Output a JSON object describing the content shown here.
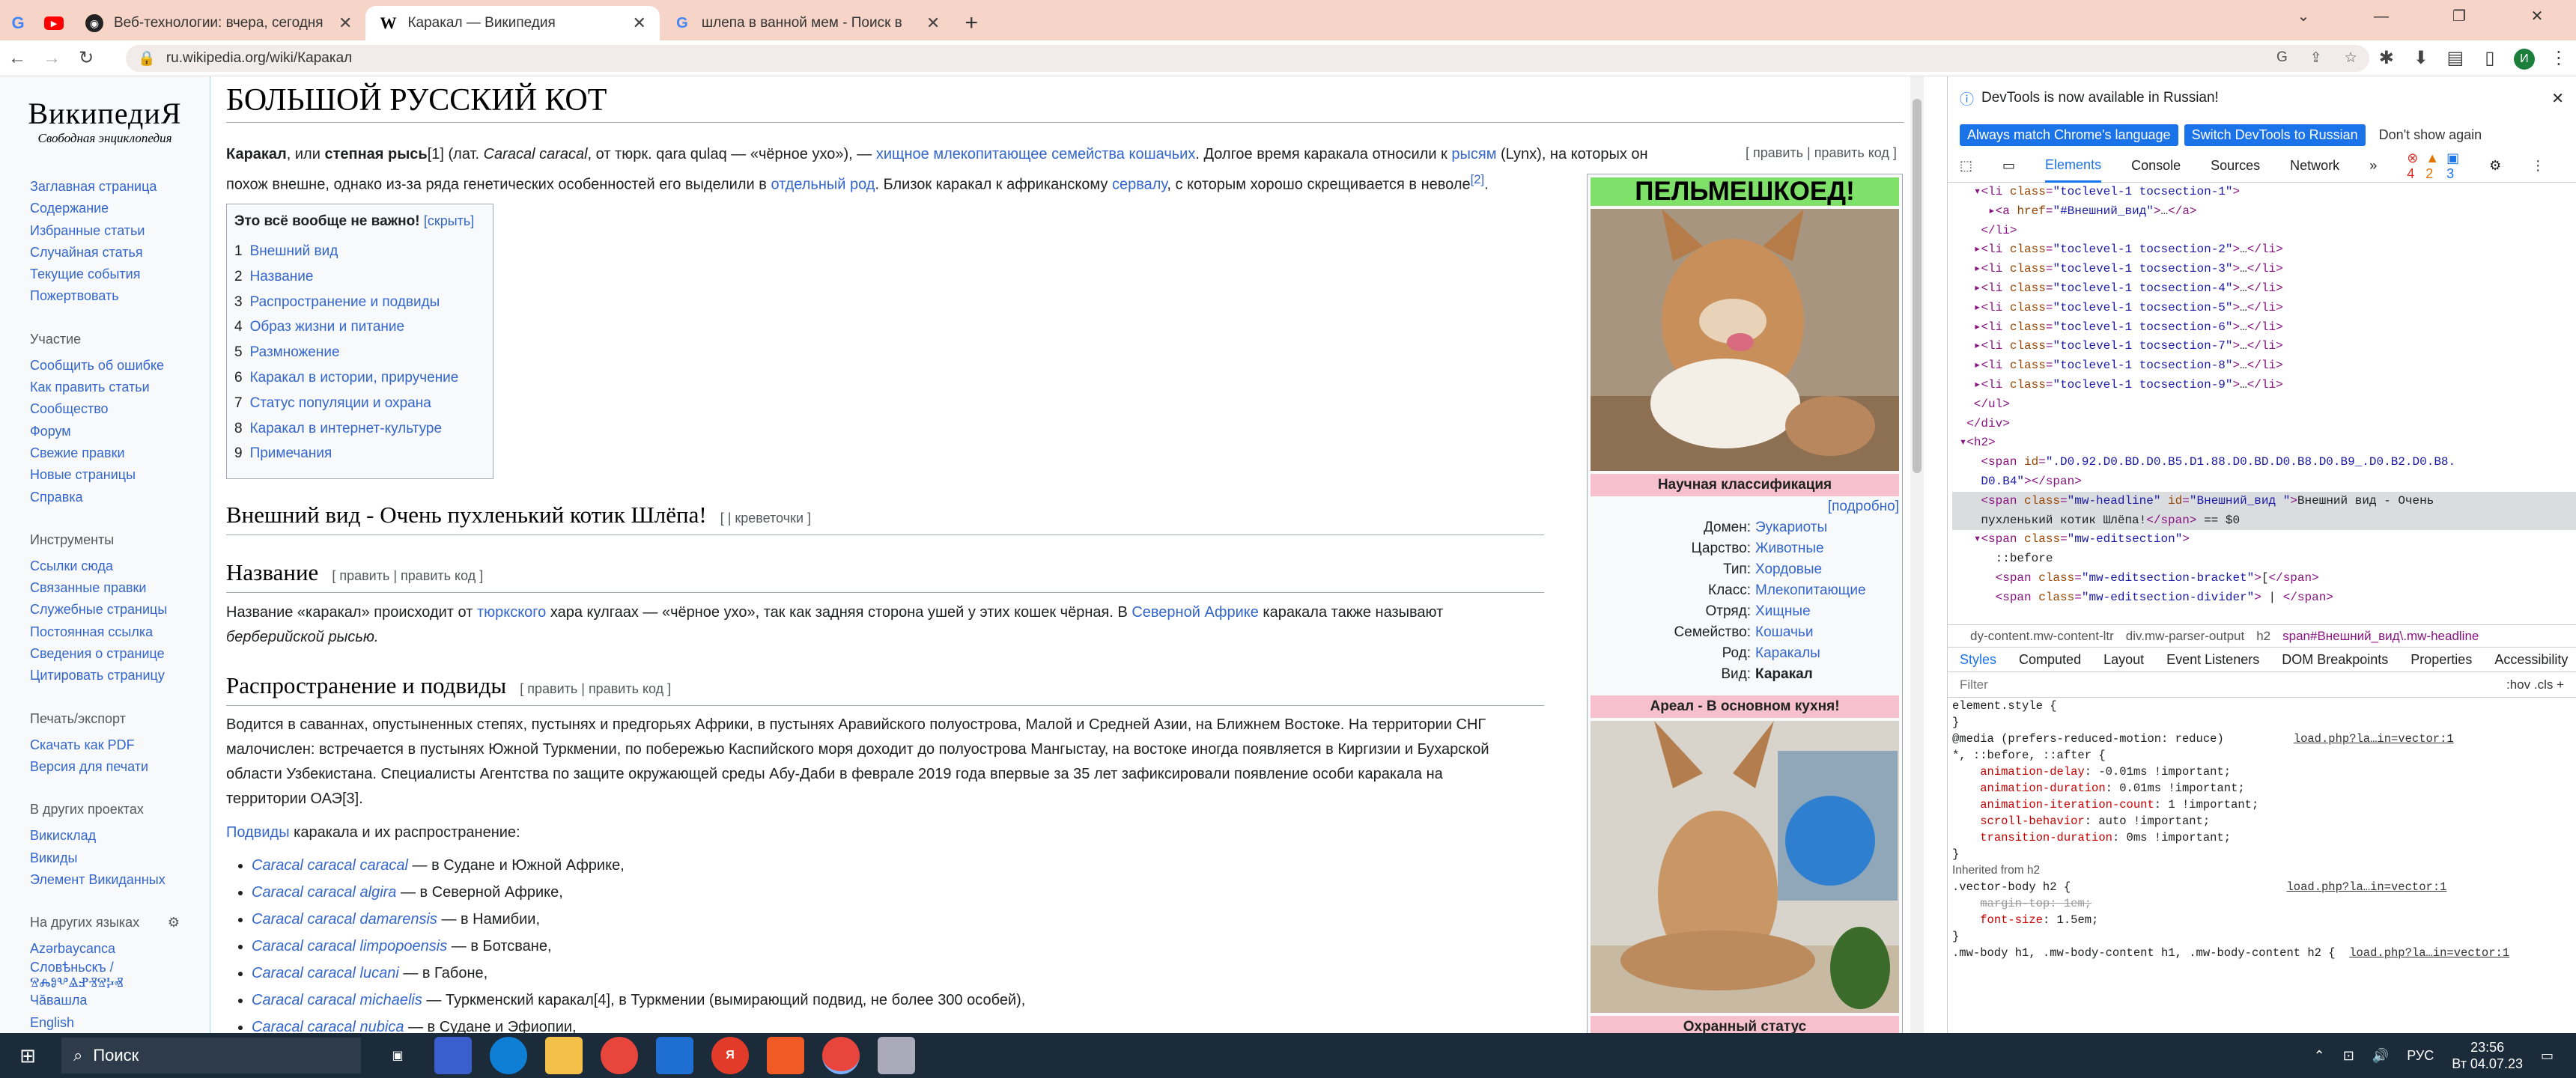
{
  "browser": {
    "tabs": [
      {
        "label": "Веб-технологии: вчера, сегодня",
        "active": false
      },
      {
        "label": "Каракал — Википедия",
        "active": true
      },
      {
        "label": "шлепа в ванной мем - Поиск в",
        "active": false
      }
    ],
    "new_tab": "+",
    "url": "ru.wikipedia.org/wiki/Каракал",
    "window_controls": [
      "⌄",
      "—",
      "❐",
      "✕"
    ]
  },
  "wiki": {
    "logo_title": "ВикипедиЯ",
    "logo_subtitle": "Свободная энциклопедия",
    "nav_main": [
      "Заглавная страница",
      "Содержание",
      "Избранные статьи",
      "Случайная статья",
      "Текущие события",
      "Пожертвовать"
    ],
    "nav_participation_head": "Участие",
    "nav_participation": [
      "Сообщить об ошибке",
      "Как править статьи",
      "Сообщество",
      "Форум",
      "Свежие правки",
      "Новые страницы",
      "Справка"
    ],
    "nav_tools_head": "Инструменты",
    "nav_tools": [
      "Ссылки сюда",
      "Связанные правки",
      "Служебные страницы",
      "Постоянная ссылка",
      "Сведения о странице",
      "Цитировать страницу"
    ],
    "nav_print_head": "Печать/экспорт",
    "nav_print": [
      "Скачать как PDF",
      "Версия для печати"
    ],
    "nav_projects_head": "В других проектах",
    "nav_projects": [
      "Викисклад",
      "Викиды",
      "Элемент Викиданных"
    ],
    "nav_lang_head": "На других языках",
    "nav_lang": [
      "Azərbaycanca",
      "Словѣньскъ / ⰔⰎⰑⰂⰡⰐⰠⰔⰍⰟ",
      "Чăвашла",
      "English"
    ],
    "title": "БОЛЬШОЙ РУССКИЙ КОТ",
    "intro_line1_a": "Каракал",
    "intro_line1_b": ", или ",
    "intro_line1_c": "степная рысь",
    "intro_line1_d": "[1] (лат. ",
    "intro_line1_e": "Caracal caracal",
    "intro_line1_f": ", от тюрк. qara qulaq — «чёрное ухо»), — ",
    "intro_link1": "хищное",
    "intro_link2": "млекопитающее",
    "intro_link3": "семейства",
    "intro_link4": "кошачьих",
    "intro_line1_g": ". Долгое время каракала относили к ",
    "intro_link5": "рысям",
    "intro_line1_h": " (Lynx), на которых он",
    "intro_line2_a": "похож внешне, однако из-за ряда генетических особенностей его выделили в ",
    "intro_link6": "отдельный род",
    "intro_line2_b": ". Близок каракал к африканскому ",
    "intro_link7": "сервалу",
    "intro_line2_c": ", с которым хорошо скрещивается в неволе",
    "intro_ref2": "[2]",
    "intro_line2_d": ".",
    "edit_links": "[ править | править код ]",
    "toc_title": "Это всё вообще не важно!",
    "toc_hide": "[скрыть]",
    "toc": [
      {
        "n": "1",
        "t": "Внешний вид"
      },
      {
        "n": "2",
        "t": "Название"
      },
      {
        "n": "3",
        "t": "Распространение и подвиды"
      },
      {
        "n": "4",
        "t": "Образ жизни и питание"
      },
      {
        "n": "5",
        "t": "Размножение"
      },
      {
        "n": "6",
        "t": "Каракал в истории, приручение"
      },
      {
        "n": "7",
        "t": "Статус популяции и охрана"
      },
      {
        "n": "8",
        "t": "Каракал в интернет-культуре"
      },
      {
        "n": "9",
        "t": "Примечания"
      }
    ],
    "h_vneshniy": "Внешний вид - Очень пухленький котик Шлёпа!",
    "h_vneshniy_edit": "[ | креветочки ]",
    "h_nazvanie": "Название",
    "h_nazvanie_edit": "[ править | править код ]",
    "nazvanie_a": "Название «каракал» происходит от ",
    "nazvanie_link1": "тюркского",
    "nazvanie_b": " хара кулгаах — «чёрное ухо», так как задняя сторона ушей у этих кошек чёрная. В ",
    "nazvanie_link2": "Северной Африке",
    "nazvanie_c": " каракала также называют",
    "nazvanie_d": "берберийской рысью.",
    "h_rasprostr": "Распространение и подвиды",
    "h_rasprostr_edit": "[ править | править код ]",
    "r_line1": "Водится в саваннах, опустыненных степях, пустынях и предгорьях Африки, в пустынях Аравийского полуострова, Малой и Средней Азии, на Ближнем Востоке. На территории СНГ",
    "r_line2": "малочислен: встречается в пустынях Южной Туркмении, по побережью Каспийского моря доходит до полуострова Мангыстау, на востоке иногда появляется в Киргизии и Бухарской",
    "r_line3": "области Узбекистана. Специалисты Агентства по защите окружающей среды Абу-Даби в феврале 2019 года впервые за 35 лет зафиксировали появление особи каракала на",
    "r_line4": "территории ОАЭ[3].",
    "podvidy_a": "Подвиды",
    "podvidy_b": " каракала и их распространение:",
    "subspecies": [
      {
        "name": "Caracal caracal caracal",
        "rest": " — в Судане и Южной Африке,"
      },
      {
        "name": "Caracal caracal algira",
        "rest": " — в Северной Африке,"
      },
      {
        "name": "Caracal caracal damarensis",
        "rest": " — в Намибии,"
      },
      {
        "name": "Caracal caracal limpopoensis",
        "rest": " — в Ботсване,"
      },
      {
        "name": "Caracal caracal lucani",
        "rest": " — в Габоне,"
      },
      {
        "name": "Caracal caracal michaelis",
        "rest": " — Туркменский каракал[4], в Туркмении (вымирающий подвид, не более 300 особей),"
      },
      {
        "name": "Caracal caracal nubica",
        "rest": " — в Судане и Эфиопии,"
      }
    ],
    "infobox": {
      "head": "ПЕЛЬМЕШКОЕД!",
      "sci": "Научная классификация",
      "more": "[подробно]",
      "rows": [
        {
          "k": "Домен:",
          "v": "Эукариоты"
        },
        {
          "k": "Царство:",
          "v": "Животные"
        },
        {
          "k": "Тип:",
          "v": "Хордовые"
        },
        {
          "k": "Класс:",
          "v": "Млекопитающие"
        },
        {
          "k": "Отряд:",
          "v": "Хищные"
        },
        {
          "k": "Семейство:",
          "v": "Кошачьи"
        },
        {
          "k": "Род:",
          "v": "Каракалы"
        },
        {
          "k": "Вид:",
          "v": "Каракал"
        }
      ],
      "area": "Ареал - В основном кухня!",
      "status": "Охранный статус"
    }
  },
  "devtools": {
    "notice": "DevTools is now available in Russian!",
    "btn1": "Always match Chrome's language",
    "btn2": "Switch DevTools to Russian",
    "btn3": "Don't show again",
    "tabs": [
      "Elements",
      "Console",
      "Sources",
      "Network",
      "»"
    ],
    "errors": "4",
    "warnings": "2",
    "info": "3",
    "crumbs": [
      "dy-content.mw-content-ltr",
      "div.mw-parser-output",
      "h2",
      "span#Внешний_вид\\.mw-headline"
    ],
    "style_tabs": [
      "Styles",
      "Computed",
      "Layout",
      "Event Listeners",
      "DOM Breakpoints",
      "Properties",
      "Accessibility"
    ],
    "filter": "Filter",
    "filter_right": ":hov  .cls  +",
    "inherited": "Inherited from h2",
    "source1": "load.php?la…in=vector:1",
    "source2": "load.php?la…in=vector:1",
    "source3": "load.php?la…in=vector:1"
  },
  "taskbar": {
    "search": "Поиск",
    "lang": "РУС",
    "time": "23:56",
    "date": "Вт 04.07.23"
  },
  "colors": {
    "link": "#3366cc",
    "tab_bar": "#f6d4c7",
    "infobox_green": "#7fe06a",
    "infobox_pink": "#f6c1cd",
    "devtools_blue": "#1a73e8"
  }
}
